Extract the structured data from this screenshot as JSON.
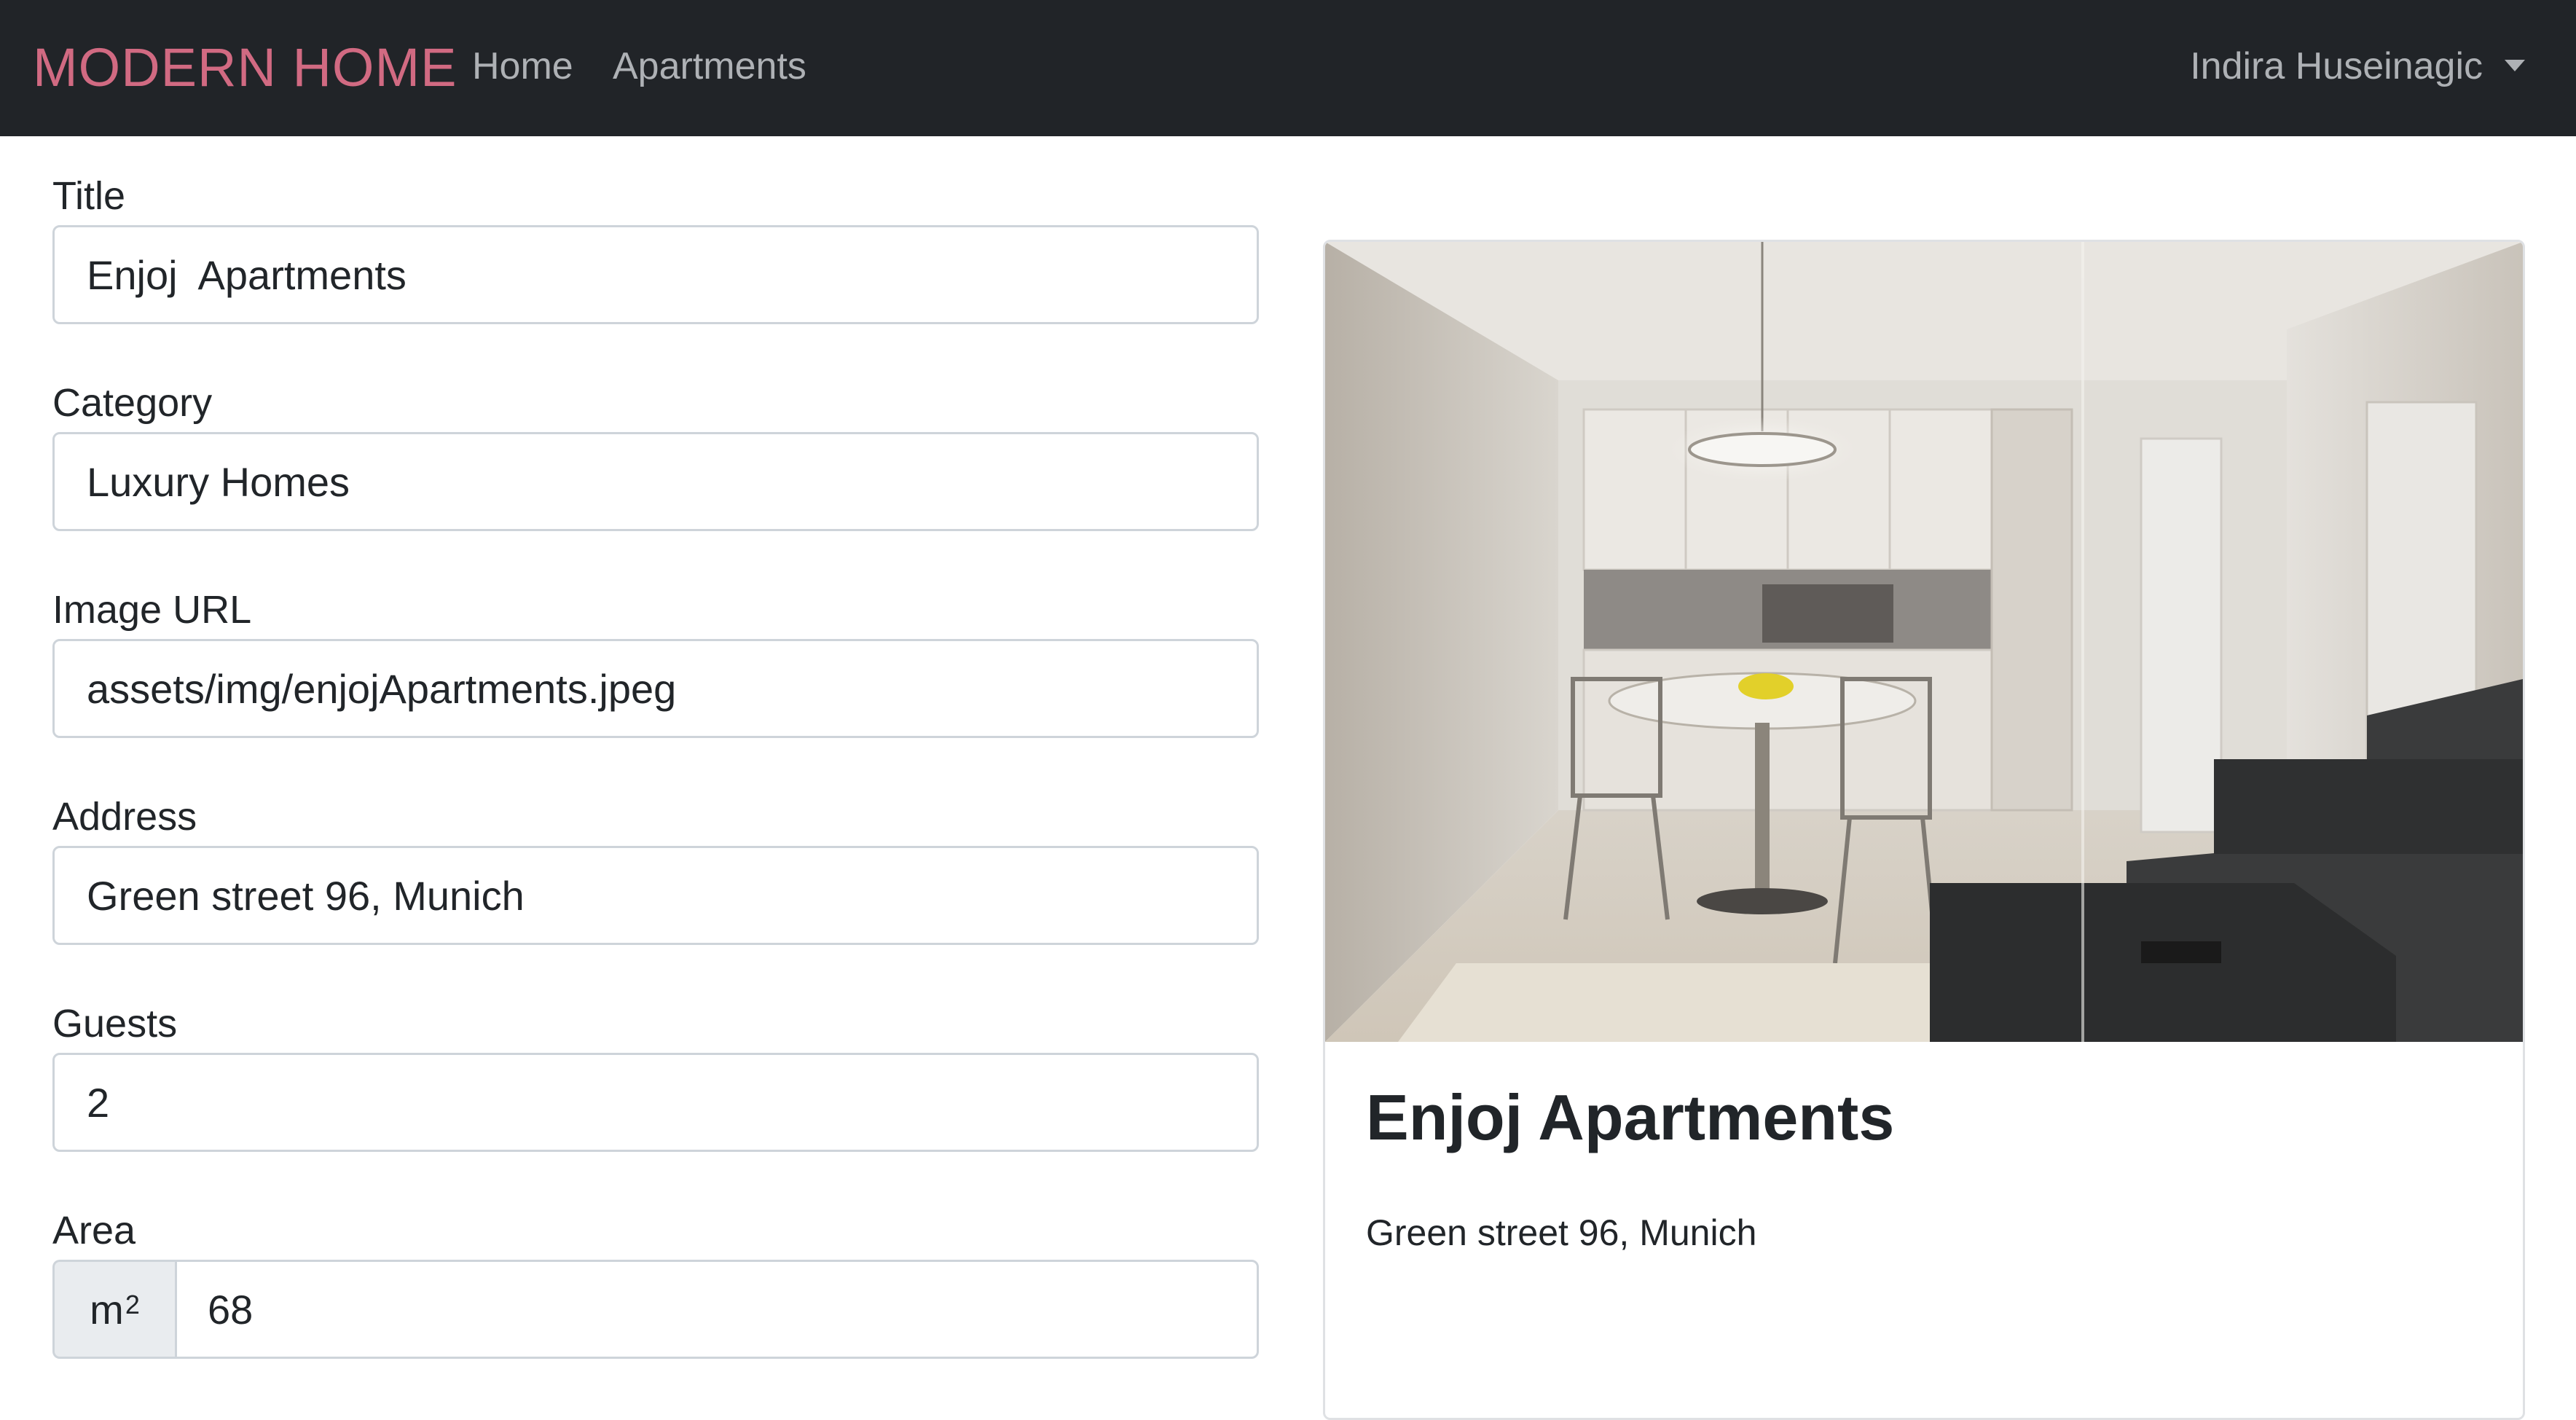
{
  "navbar": {
    "brand": "MODERN HOME",
    "links": [
      "Home",
      "Apartments"
    ],
    "user": "Indira Huseinagic"
  },
  "form": {
    "title_label": "Title",
    "title_value": "Enjoj  Apartments",
    "category_label": "Category",
    "category_value": "Luxury Homes",
    "image_label": "Image URL",
    "image_value": "assets/img/enjojApartments.jpeg",
    "address_label": "Address",
    "address_value": "Green street 96, Munich",
    "guests_label": "Guests",
    "guests_value": "2",
    "area_label": "Area",
    "area_unit": "m",
    "area_unit_sup": "2",
    "area_value": "68"
  },
  "card": {
    "title": "Enjoj Apartments",
    "address": "Green street 96, Munich"
  },
  "colors": {
    "navbar_bg": "#212428",
    "brand": "#d16a82",
    "nav_link": "#aeb1b5",
    "input_border": "#ced4da",
    "addon_bg": "#e9ecef"
  }
}
